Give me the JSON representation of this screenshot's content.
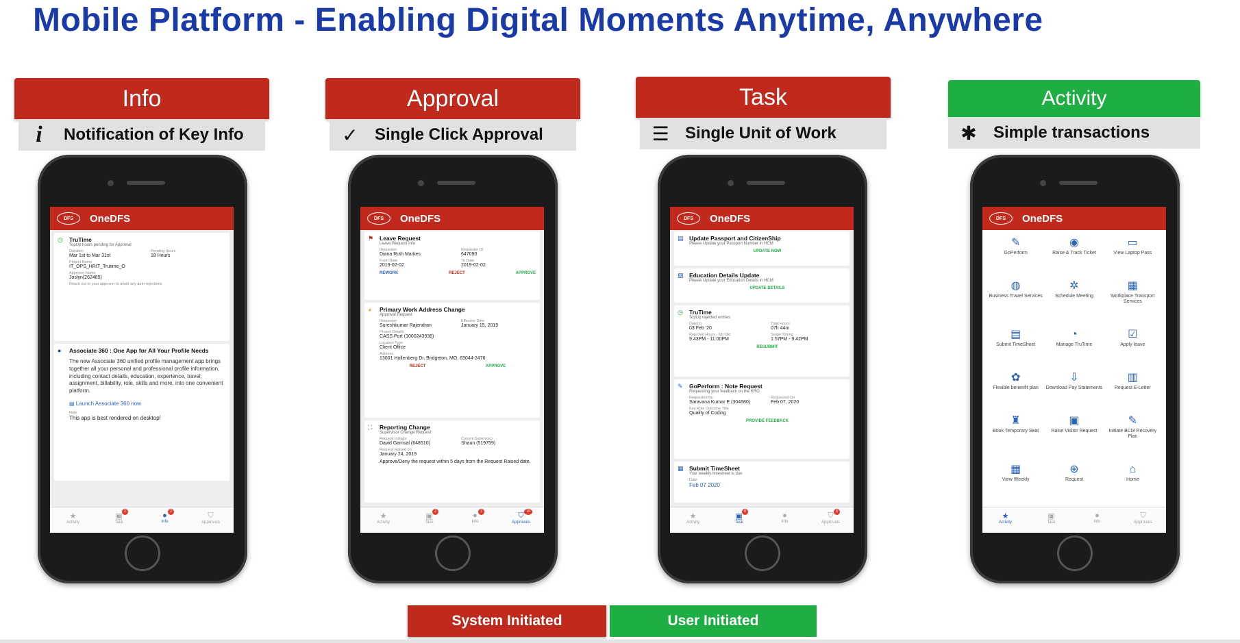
{
  "title": "Mobile Platform - Enabling Digital Moments Anytime,  Anywhere",
  "app_name": "OneDFS",
  "app_logo": "DFS",
  "colors": {
    "red": "#bf2a1d",
    "green": "#1fae44",
    "title_blue": "#1a3aa8"
  },
  "columns": [
    {
      "header": "Info",
      "subtitle": "Notification of Key Info",
      "icon": "info-icon",
      "glyph": "i"
    },
    {
      "header": "Approval",
      "subtitle": "Single Click Approval",
      "icon": "checkmark-icon",
      "glyph": "✓"
    },
    {
      "header": "Task",
      "subtitle": "Single Unit of Work",
      "icon": "checklist-icon",
      "glyph": "☰"
    },
    {
      "header": "Activity",
      "subtitle": "Simple transactions",
      "icon": "gear-icon",
      "glyph": "✱"
    }
  ],
  "tabs": [
    "Activity",
    "Task",
    "Info",
    "Approvals"
  ],
  "tab_glyphs": [
    "★",
    "▣",
    "●",
    "⛉"
  ],
  "info_screen": {
    "trutime": {
      "title": "TruTime",
      "sub": "TopUp hours pending for Approval",
      "duration_k": "Duration",
      "duration_v": "Mar 1st to Mar 31st",
      "pending_k": "Pending Hours",
      "pending_v": "18 Hours",
      "project_k": "Project Name",
      "project_v": "IT_OPS_HRIT_Trutime_O",
      "approver_k": "Approver Name",
      "approver_v": "Joslyn(262485)",
      "note": "Reach out to your approver to avoid any auto-rejections"
    },
    "associate": {
      "title": "Associate 360 : One App for All Your Profile Needs",
      "body": "The new Associate 360 unified profile management app brings together all your personal and professional profile information, including contact details, education, experience, travel, assignment, billability, role, skills and more, into one convenient platform.",
      "link": "Launch Associate 360 now",
      "note_k": "Note",
      "note_v": "This app is best rendered on desktop!"
    },
    "badges": [
      "2",
      "2"
    ]
  },
  "approval_screen": {
    "leave": {
      "title": "Leave Request",
      "sub": "Leave Request Info",
      "req_k": "Requester",
      "req_v": "Diana Ruth Markes",
      "id_k": "Requester ID",
      "id_v": "647090",
      "from_k": "From Date",
      "from_v": "2019-02-02",
      "to_k": "To Date",
      "to_v": "2019-02-02",
      "a1": "REWORK",
      "a2": "REJECT",
      "a3": "APPROVE"
    },
    "address": {
      "title": "Primary Work Address Change",
      "sub": "Approval Request",
      "req_k": "Requester",
      "req_v": "Sureshkumar Rajendran",
      "eff_k": "Effective Date",
      "eff_v": "January 15, 2019",
      "proj_k": "Project Details",
      "proj_v": "CASS Port (1000243936)",
      "loc_k": "Location Type",
      "loc_v": "Client Office",
      "addr_k": "Address",
      "addr_v": "13001 Hollenberg Dr, Bridgeton, MO, 63044-2476",
      "a1": "REJECT",
      "a2": "APPROVE"
    },
    "reporting": {
      "title": "Reporting Change",
      "sub": "Supervisor Change Request",
      "init_k": "Request Initiator",
      "init_v": "David Gamsal (648510)",
      "cur_k": "Current Supervisor",
      "cur_v": "Shaun (519759)",
      "raised_k": "Request Raised on",
      "raised_v": "January 24, 2019",
      "body": "Approve/Deny the request within 5 days from the Request Raised date."
    },
    "badges": [
      "2",
      "1",
      "10"
    ]
  },
  "task_screen": {
    "passport": {
      "title": "Update Passport and CitizenShip",
      "sub": "Please Update your Passport Number in HCM",
      "action": "UPDATE NOW"
    },
    "education": {
      "title": "Education Details Update",
      "sub": "Please Update your Education Details in HCM",
      "action": "UPDATE DETAILS"
    },
    "trutime": {
      "title": "TruTime",
      "sub": "TopUp rejected entries",
      "date_k": "Date(s)",
      "date_v": "03 Feb '20",
      "total_k": "Total Hours",
      "total_v": "07h 44m",
      "rej_k": "Rejected Hours - 6th Okt",
      "rej_v": "9:43PM - 11:00PM",
      "swipe_k": "Swipe Timing",
      "swipe_v": "1:57PM - 9:42PM",
      "action": "RESUBMIT"
    },
    "goperform": {
      "title": "GoPerform : Note Request",
      "sub": "Requesting your feedback on the KRO",
      "by_k": "Requested By",
      "by_v": "Saravana Kumar E (304680)",
      "on_k": "Requested On",
      "on_v": "Feb 07, 2020",
      "kro_k": "Key Role Outcome Title",
      "kro_v": "Quality of Coding",
      "action": "PROVIDE FEEDBACK"
    },
    "timesheet": {
      "title": "Submit TimeSheet",
      "sub": "Your weekly timesheet is due",
      "date_k": "Date",
      "date_v": "Feb 07 2020"
    },
    "badges": [
      "8",
      "8"
    ]
  },
  "activity_screen": {
    "items": [
      {
        "label": "GoPerform",
        "icon": "goperform-icon",
        "glyph": "✎"
      },
      {
        "label": "Raise & Track Ticket",
        "icon": "eye-icon",
        "glyph": "◉"
      },
      {
        "label": "View Laptop Pass",
        "icon": "laptop-icon",
        "glyph": "▭"
      },
      {
        "label": "Business Travel Services",
        "icon": "globe-icon",
        "glyph": "◍"
      },
      {
        "label": "Schedule Meeting",
        "icon": "meeting-icon",
        "glyph": "✲"
      },
      {
        "label": "Workplace Transport Services",
        "icon": "bus-icon",
        "glyph": "▦"
      },
      {
        "label": "Submit TimeSheet",
        "icon": "calendar-clock-icon",
        "glyph": "▤"
      },
      {
        "label": "Manage TruTime",
        "icon": "clock-icon",
        "glyph": "◔"
      },
      {
        "label": "Apply leave",
        "icon": "calendar-check-icon",
        "glyph": "☑"
      },
      {
        "label": "Flexible benenfit plan",
        "icon": "benefit-icon",
        "glyph": "✿"
      },
      {
        "label": "Download Pay Statements",
        "icon": "download-icon",
        "glyph": "⇩"
      },
      {
        "label": "Request E-Letter",
        "icon": "letter-icon",
        "glyph": "▥"
      },
      {
        "label": "Book Temporary Seat",
        "icon": "seat-icon",
        "glyph": "♜"
      },
      {
        "label": "Raise Visitor Request",
        "icon": "visitor-icon",
        "glyph": "▣"
      },
      {
        "label": "Initiate BCM Recovery Plan",
        "icon": "bcm-icon",
        "glyph": "✎"
      },
      {
        "label": "View Weekly",
        "icon": "weekly-icon",
        "glyph": "▦"
      },
      {
        "label": "Request",
        "icon": "request-icon",
        "glyph": "⊕"
      },
      {
        "label": "Home",
        "icon": "home-icon",
        "glyph": "⌂"
      }
    ]
  },
  "footer": {
    "system": "System Initiated",
    "user": "User Initiated"
  }
}
